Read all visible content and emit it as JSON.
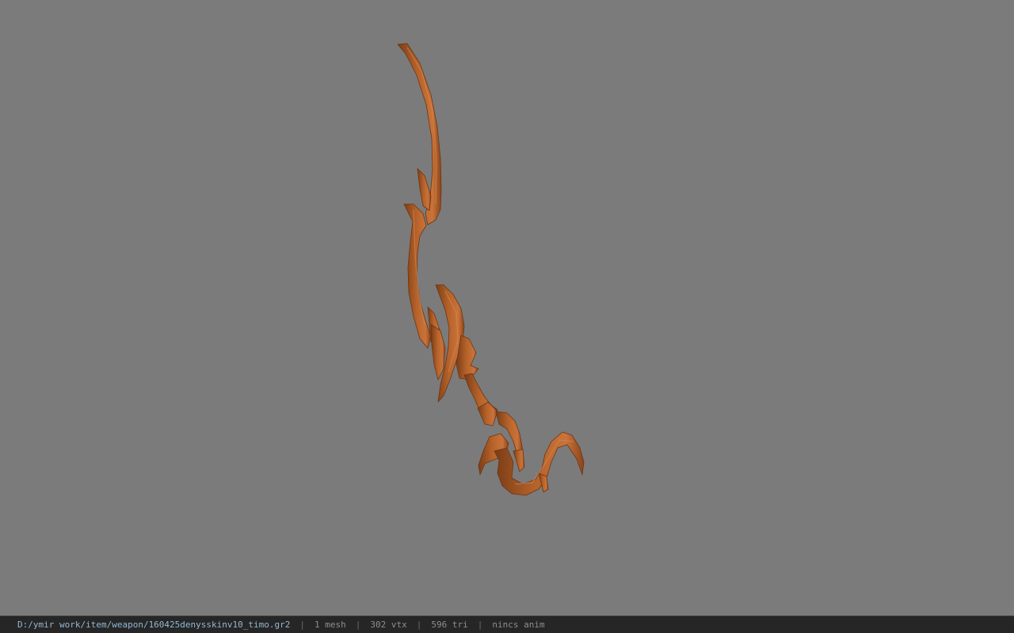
{
  "viewport": {
    "background_color": "#7b7b7b",
    "model_color": "#b5622a",
    "model_shade_color": "#7a3d17",
    "model_highlight_color": "#d68a4f"
  },
  "statusbar": {
    "path": "D:/ymir work/item/weapon/160425denysskinv10_timo.gr2",
    "separator": "|",
    "mesh": "1 mesh",
    "vertices": "302 vtx",
    "triangles": "596 tri",
    "anim": "nincs anim"
  }
}
